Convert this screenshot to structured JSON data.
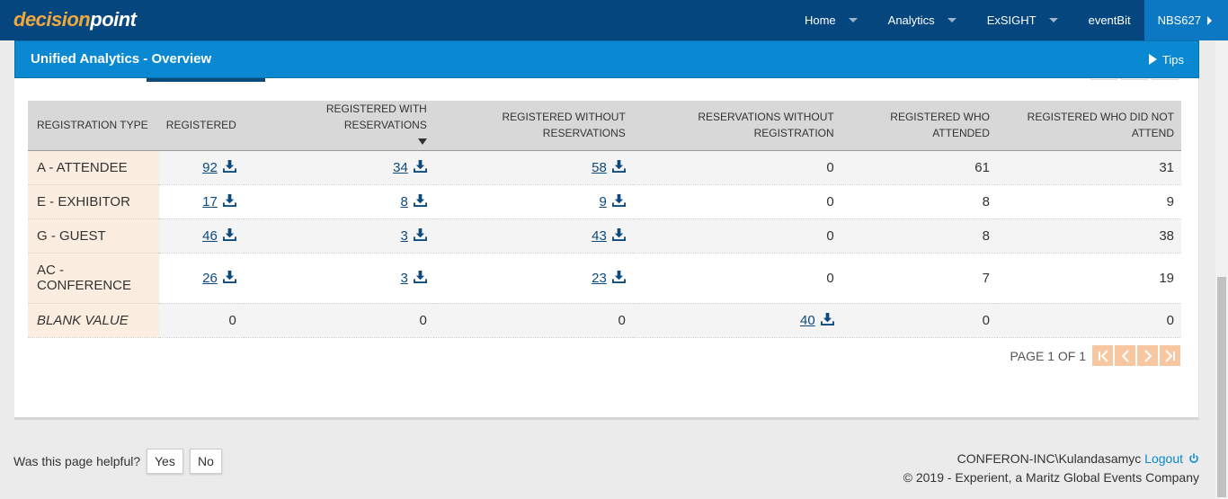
{
  "brand": {
    "logo_part1": "decision",
    "logo_part2": "point"
  },
  "nav": {
    "home": "Home",
    "analytics": "Analytics",
    "exsight": "ExSIGHT",
    "eventbit": "eventBit",
    "user": "NBS627"
  },
  "page": {
    "title": "Unified Analytics - Overview",
    "tips": "Tips"
  },
  "table": {
    "headers": {
      "reg_type": "REGISTRATION TYPE",
      "registered": "REGISTERED",
      "with_res": "REGISTERED WITH RESERVATIONS",
      "without_res_1": "REGISTERED WITHOUT",
      "without_res_2": "RESERVATIONS",
      "res_without_1": "RESERVATIONS WITHOUT",
      "res_without_2": "REGISTRATION",
      "attended_1": "REGISTERED WHO",
      "attended_2": "ATTENDED",
      "not_attend_1": "REGISTERED WHO DID NOT",
      "not_attend_2": "ATTEND"
    },
    "rows": [
      {
        "type": "A - ATTENDEE",
        "registered": "92",
        "with_res": "34",
        "without_res": "58",
        "res_without_reg": "0",
        "attended": "61",
        "not_attended": "31"
      },
      {
        "type": "E - EXHIBITOR",
        "registered": "17",
        "with_res": "8",
        "without_res": "9",
        "res_without_reg": "0",
        "attended": "8",
        "not_attended": "9"
      },
      {
        "type": "G - GUEST",
        "registered": "46",
        "with_res": "3",
        "without_res": "43",
        "res_without_reg": "0",
        "attended": "8",
        "not_attended": "38"
      },
      {
        "type_line1": "AC -",
        "type_line2": "CONFERENCE",
        "registered": "26",
        "with_res": "3",
        "without_res": "23",
        "res_without_reg": "0",
        "attended": "7",
        "not_attended": "19"
      },
      {
        "type": "BLANK VALUE",
        "registered": "0",
        "with_res": "0",
        "without_res": "0",
        "res_without_reg": "40",
        "attended": "0",
        "not_attended": "0"
      }
    ]
  },
  "pagination": {
    "label": "PAGE 1 OF 1"
  },
  "footer": {
    "helpful": "Was this page helpful?",
    "yes": "Yes",
    "no": "No",
    "account": "CONFERON-INC\\Kulandasamyc",
    "logout": "Logout",
    "copyright": "© 2019 - Experient, a Maritz Global Events Company"
  },
  "colors": {
    "nav_bg": "#06467e",
    "title_bar": "#0a88d1",
    "user_tab": "#0c78c4",
    "logo_accent": "#f2a93b",
    "link": "#0c4a7e",
    "reg_type_cell": "#fbeee0",
    "pager_button": "#f6c7a1"
  },
  "icons": {
    "download": "download-icon",
    "tips": "play-icon",
    "logout": "power-icon"
  }
}
